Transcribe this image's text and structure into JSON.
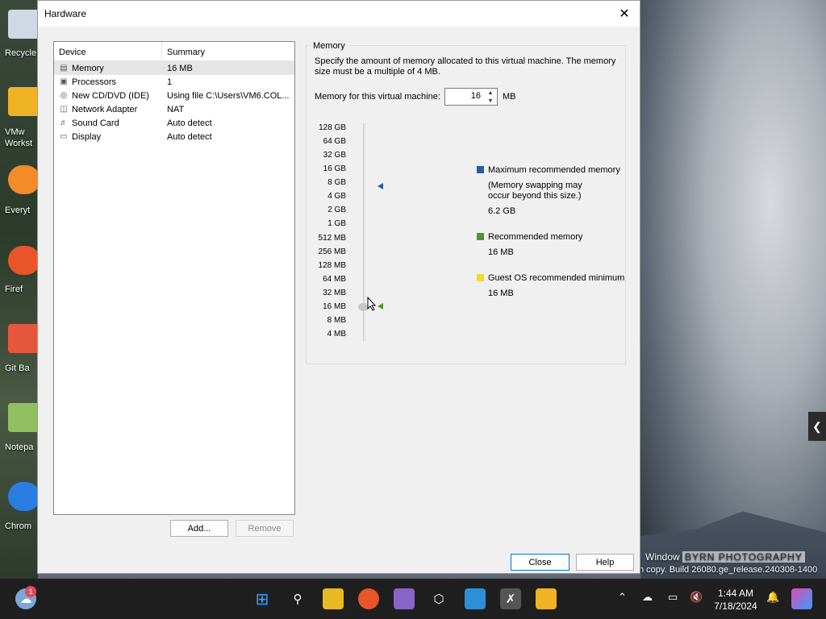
{
  "dialog": {
    "title": "Hardware",
    "device_list": {
      "headers": [
        "Device",
        "Summary"
      ],
      "rows": [
        {
          "icon": "memory-icon",
          "device": "Memory",
          "summary": "16 MB"
        },
        {
          "icon": "processor-icon",
          "device": "Processors",
          "summary": "1"
        },
        {
          "icon": "cd-dvd-icon",
          "device": "New CD/DVD (IDE)",
          "summary": "Using file C:\\Users\\VM6.COL..."
        },
        {
          "icon": "network-adapter-icon",
          "device": "Network Adapter",
          "summary": "NAT"
        },
        {
          "icon": "sound-card-icon",
          "device": "Sound Card",
          "summary": "Auto detect"
        },
        {
          "icon": "display-icon",
          "device": "Display",
          "summary": "Auto detect"
        }
      ]
    },
    "add_label": "Add...",
    "remove_label": "Remove",
    "close_label": "Close",
    "help_label": "Help"
  },
  "memory": {
    "group_label": "Memory",
    "description": "Specify the amount of memory allocated to this virtual machine. The memory size must be a multiple of 4 MB.",
    "field_label": "Memory for this virtual machine:",
    "value": "16",
    "unit": "MB",
    "scale": [
      "128 GB",
      "64 GB",
      "32 GB",
      "16 GB",
      "8 GB",
      "4 GB",
      "2 GB",
      "1 GB",
      "512 MB",
      "256 MB",
      "128 MB",
      "64 MB",
      "32 MB",
      "16 MB",
      "8 MB",
      "4 MB"
    ],
    "legend": {
      "max_title": "Maximum recommended memory",
      "max_note": "(Memory swapping may occur beyond this size.)",
      "max_value": "6.2 GB",
      "rec_title": "Recommended memory",
      "rec_value": "16 MB",
      "min_title": "Guest OS recommended minimum",
      "min_value": "16 MB"
    },
    "colors": {
      "max": "#1f5fa8",
      "rec": "#4a9a2a",
      "min": "#f2d92b"
    }
  },
  "desktop": {
    "icons": [
      "Recycle",
      "VMw Workst",
      "Everyt",
      "Firef",
      "Git Ba",
      "Notepa",
      "Chrom"
    ],
    "watermark_1": "Window",
    "watermark_logo": "BYRN PHOTOGRAPHY",
    "watermark_2": "n copy. Build 26080.ge_release.240308-1400"
  },
  "taskbar": {
    "weather_badge": "1",
    "time": "1:44 AM",
    "date": "7/18/2024"
  }
}
